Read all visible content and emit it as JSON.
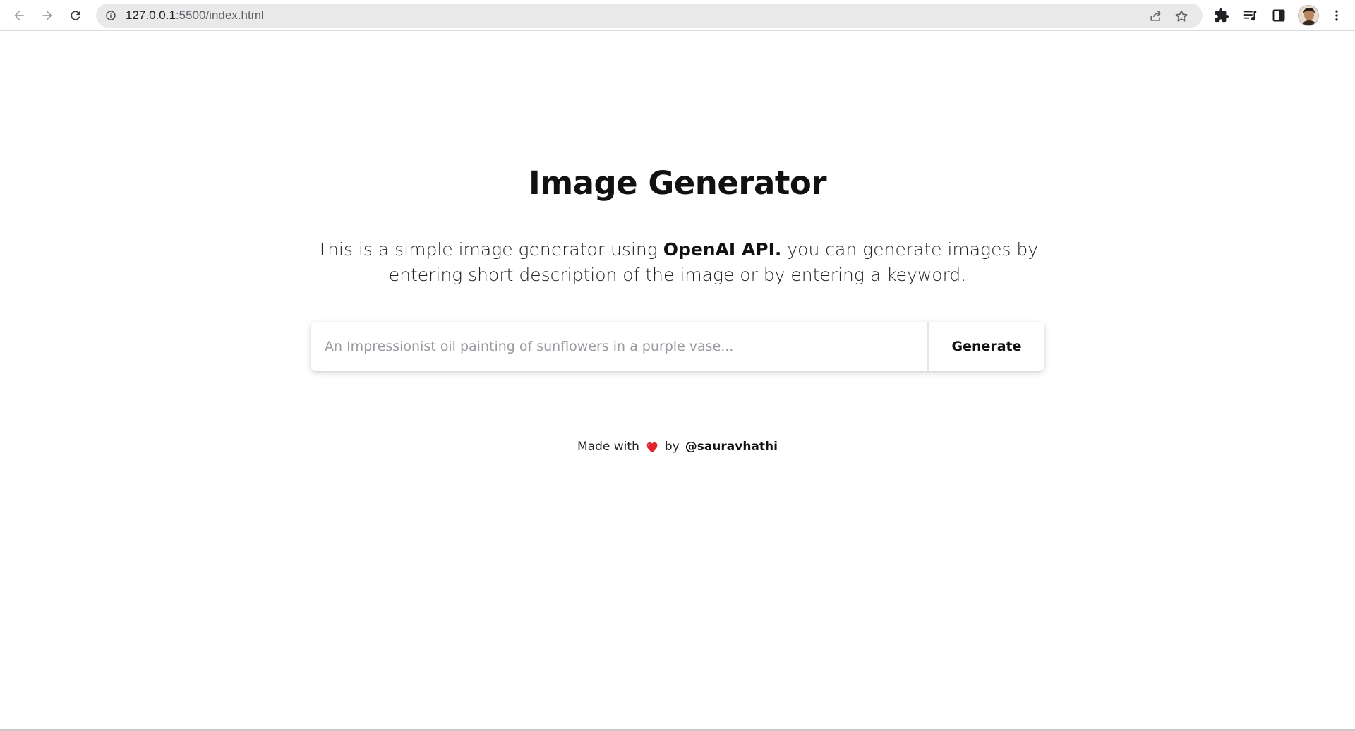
{
  "browser": {
    "url_host": "127.0.0.1",
    "url_path": ":5500/index.html",
    "icons": [
      "back-arrow-icon",
      "forward-arrow-icon",
      "reload-icon",
      "info-icon",
      "share-icon",
      "star-icon",
      "extensions-puzzle-icon",
      "media-queue-icon",
      "side-panel-icon",
      "profile-avatar",
      "more-menu-icon"
    ]
  },
  "main": {
    "title": "Image Generator",
    "description_pre": "This is a simple image generator using ",
    "description_bold": "OpenAI API.",
    "description_post": " you can generate images by entering short description of the image or by entering a keyword."
  },
  "form": {
    "input_value": "",
    "input_placeholder": "An Impressionist oil painting of sunflowers in a purple vase...",
    "button_label": "Generate"
  },
  "footer": {
    "made_with": "Made with",
    "by": "by",
    "author": "@sauravhathi"
  },
  "colors": {
    "heart": "#e0242c",
    "omnibox_bg": "#e9e9ea",
    "text": "#111111"
  }
}
